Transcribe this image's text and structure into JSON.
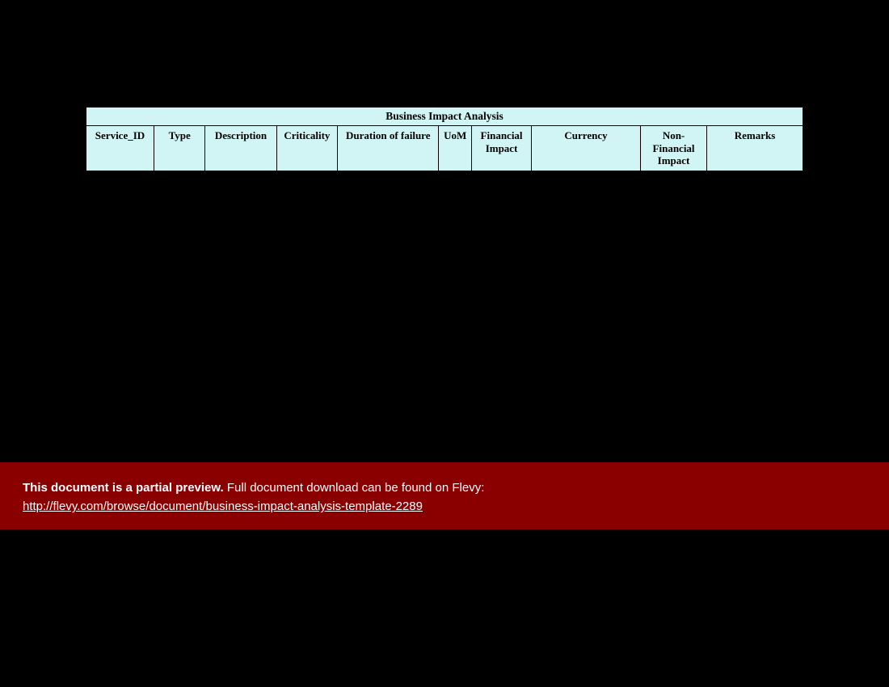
{
  "table": {
    "title": "Business Impact Analysis",
    "columns": [
      "Service_ID",
      "Type",
      "Description",
      "Criticality",
      "Duration of failure",
      "UoM",
      "Financial Impact",
      "Currency",
      "Non-Financial Impact",
      "Remarks"
    ]
  },
  "banner": {
    "bold_text": "This document is a partial preview.",
    "rest_text": "  Full document download can be found on Flevy:",
    "link_text": "http://flevy.com/browse/document/business-impact-analysis-template-2289"
  }
}
